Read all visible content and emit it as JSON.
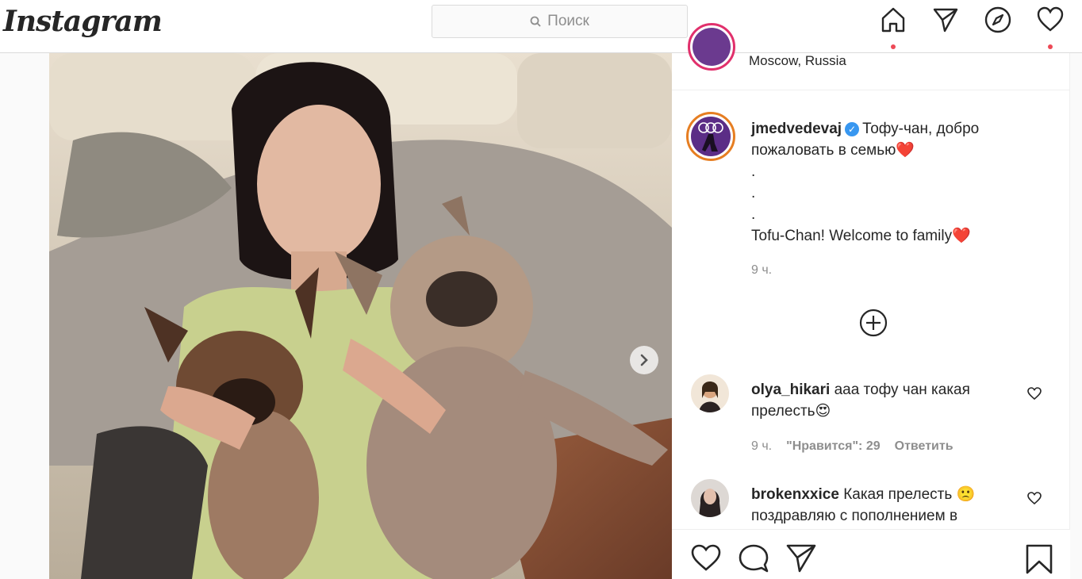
{
  "header": {
    "logo": "Instagram",
    "search_placeholder": "Поиск",
    "icons": [
      "home-icon",
      "direct-icon",
      "explore-icon",
      "activity-icon"
    ]
  },
  "post": {
    "location": "Moscow, Russia",
    "author": "jmedvedevaj",
    "caption_line1": "Тофу-чан, добро пожаловать в семью",
    "caption_dots": [
      ".",
      ".",
      "."
    ],
    "caption_line2": "Tofu-Chan! Welcome to family",
    "time": "9 ч."
  },
  "comments": [
    {
      "user": "olya_hikari",
      "text": "ааа тофу чан какая прелесть",
      "emoji": "😍",
      "time": "9 ч.",
      "likes": "\"Нравится\": 29",
      "reply": "Ответить"
    },
    {
      "user": "brokenxxice",
      "text": "Какая прелесть",
      "emoji": "🙁",
      "text2": "поздравляю с пополнением в"
    }
  ],
  "colors": {
    "accent_red": "#ed4956",
    "verified_blue": "#3897f0",
    "heart_red": "#e0243a"
  }
}
